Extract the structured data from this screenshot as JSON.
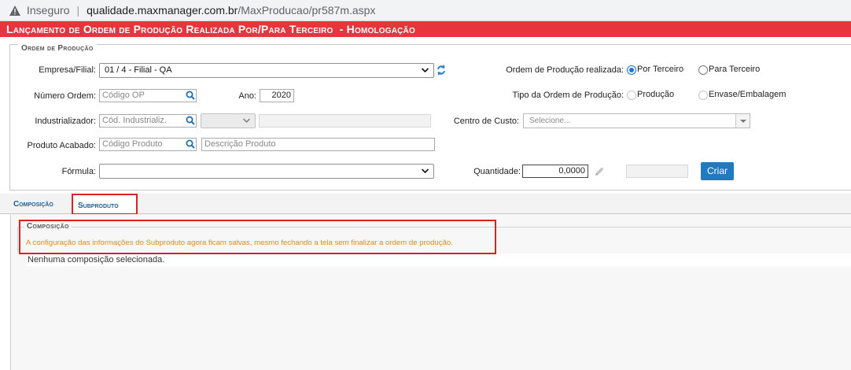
{
  "browser": {
    "security_label": "Inseguro",
    "url_host": "qualidade.maxmanager.com.br",
    "url_path": "/MaxProducao/pr587m.aspx"
  },
  "page": {
    "title": "Lançamento de Ordem de Produção Realizada Por/Para Terceiro  - Homologação"
  },
  "form": {
    "legend": "Ordem de Produção",
    "empresa": {
      "label": "Empresa/Filial:",
      "value": "01 / 4 - Filial - QA"
    },
    "ordem_realizada": {
      "label": "Ordem de Produção realizada:",
      "options": [
        {
          "label": "Por Terceiro",
          "selected": true
        },
        {
          "label": "Para Terceiro",
          "selected": false
        }
      ]
    },
    "numero_ordem": {
      "label": "Número Ordem:",
      "placeholder": "Código OP"
    },
    "ano": {
      "label": "Ano:",
      "value": "2020"
    },
    "tipo_ordem": {
      "label": "Tipo da Ordem de Produção:",
      "options": [
        {
          "label": "Produção",
          "selected": false
        },
        {
          "label": "Envase/Embalagem",
          "selected": false
        }
      ]
    },
    "industrializador": {
      "label": "Industrializador:",
      "placeholder": "Cód. Industrializ."
    },
    "centro_custo": {
      "label": "Centro de Custo:",
      "placeholder": "Selecione..."
    },
    "produto_acabado": {
      "label": "Produto Acabado:",
      "code_placeholder": "Código Produto",
      "desc_placeholder": "Descrição Produto"
    },
    "formula": {
      "label": "Fórmula:",
      "value": ""
    },
    "quantidade": {
      "label": "Quantidade:",
      "value": "0,0000"
    },
    "criar_button": "Criar"
  },
  "tabs": [
    {
      "label": "Composição",
      "active": false
    },
    {
      "label": "Subproduto",
      "active": true
    }
  ],
  "subproduto": {
    "legend": "Composição",
    "notice": "A configuração das informações do Subproduto agora ficam salvas, mesmo fechando a tela sem finalizar a ordem de produção.",
    "empty_message": "Nenhuma composição selecionada."
  },
  "colors": {
    "title_bar": "#e8353b",
    "accent": "#1f7ac0",
    "highlight_box": "#e01e26",
    "notice_text": "#e48a10"
  },
  "icons": [
    "warning-icon",
    "search-icon",
    "refresh-icon",
    "pencil-icon",
    "chevron-down-icon"
  ]
}
